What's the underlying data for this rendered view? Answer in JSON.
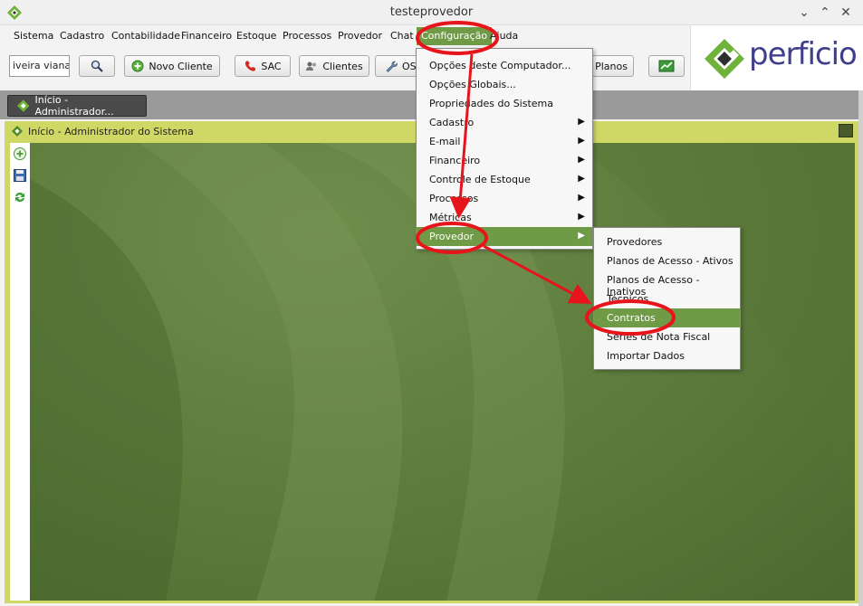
{
  "window": {
    "title": "testeprovedor"
  },
  "menubar": {
    "items": [
      {
        "label": "Sistema"
      },
      {
        "label": "Cadastro"
      },
      {
        "label": "Contabilidade"
      },
      {
        "label": "Financeiro"
      },
      {
        "label": "Estoque"
      },
      {
        "label": "Processos"
      },
      {
        "label": "Provedor"
      },
      {
        "label": "Chat"
      },
      {
        "label": "Configuração"
      },
      {
        "label": "Ajuda"
      }
    ]
  },
  "toolbar": {
    "search_value": "iveira viana",
    "novo_cliente": "Novo Cliente",
    "sac": "SAC",
    "clientes": "Clientes",
    "os": "OS",
    "planos": "Planos"
  },
  "logo": {
    "text": "perficio"
  },
  "tabs": [
    {
      "label": "Início - Administrador..."
    }
  ],
  "inner": {
    "title": "Início - Administrador do Sistema"
  },
  "config_menu": {
    "items": [
      {
        "label": "Opções deste Computador..."
      },
      {
        "label": "Opções Globais..."
      },
      {
        "label": "Propriedades do Sistema"
      },
      {
        "label": "Cadastro"
      },
      {
        "label": "E-mail"
      },
      {
        "label": "Financeiro"
      },
      {
        "label": "Controle de Estoque"
      },
      {
        "label": "Processos"
      },
      {
        "label": "Métricas"
      },
      {
        "label": "Provedor"
      }
    ]
  },
  "provedor_menu": {
    "items": [
      {
        "label": "Provedores"
      },
      {
        "label": "Planos de Acesso - Ativos"
      },
      {
        "label": "Planos de Acesso - Inativos"
      },
      {
        "label": "Técnicos"
      },
      {
        "label": "Contratos"
      },
      {
        "label": "Séries de Nota Fiscal"
      },
      {
        "label": "Importar Dados"
      }
    ]
  },
  "colors": {
    "accent": "#6f9a46",
    "annotation": "#e8141b",
    "logo_green": "#6fb33a",
    "logo_blue": "#3f3f8c"
  },
  "icons": [
    "perficio-app-icon",
    "search-icon",
    "add-icon",
    "phone-icon",
    "clients-icon",
    "wrench-icon",
    "chart-icon",
    "save-icon",
    "refresh-icon",
    "restore-icon"
  ]
}
